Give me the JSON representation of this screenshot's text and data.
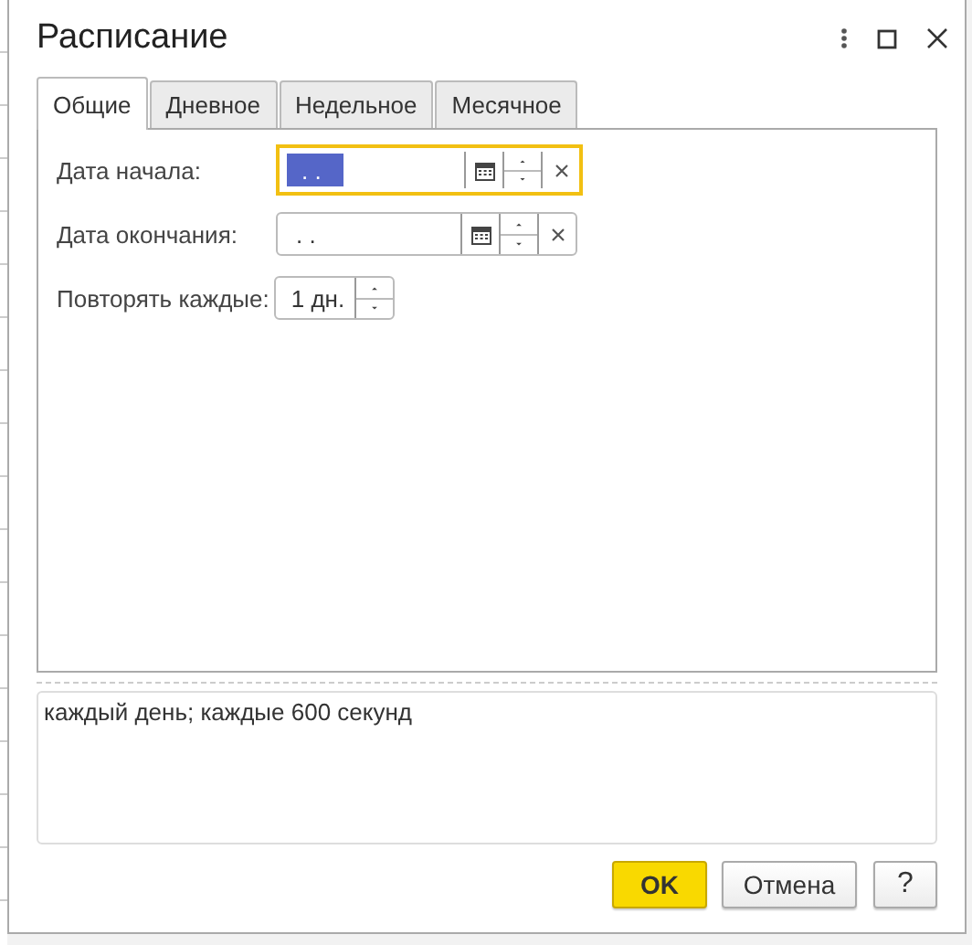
{
  "window": {
    "title": "Расписание"
  },
  "tabs": [
    {
      "label": "Общие",
      "selected": true
    },
    {
      "label": "Дневное",
      "selected": false
    },
    {
      "label": "Недельное",
      "selected": false
    },
    {
      "label": "Месячное",
      "selected": false
    }
  ],
  "fields": [
    {
      "kind": "date",
      "label": "Дата начала:",
      "value": ". .",
      "focused": true
    },
    {
      "kind": "date",
      "label": "Дата окончания:",
      "value": ". .",
      "focused": false
    },
    {
      "kind": "number",
      "label": "Повторять каждые:",
      "value": "1 дн.",
      "focused": false
    }
  ],
  "summary": {
    "text": "каждый день; каждые 600 секунд"
  },
  "buttons": [
    {
      "label": "OK",
      "kind": "default"
    },
    {
      "label": "Отмена",
      "kind": "normal"
    },
    {
      "label": "?",
      "kind": "help"
    }
  ]
}
